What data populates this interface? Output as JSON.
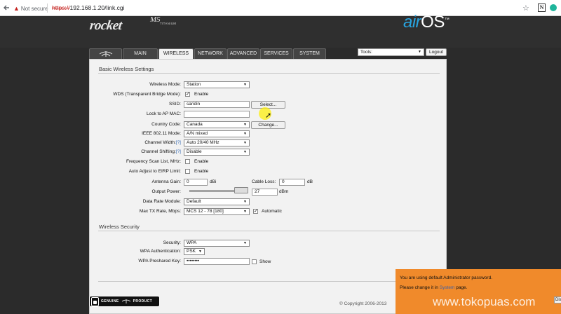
{
  "browser": {
    "security_label": "Not secure",
    "url_scheme": "https://",
    "url_host": "192.168.1.20/link.cgi"
  },
  "header": {
    "brand_rocket": "rocket",
    "brand_model": "M5",
    "brand_variant": "TITANIUM",
    "brand_air": "air",
    "brand_os": "OS",
    "brand_tm": "™"
  },
  "tabs": [
    {
      "label": ""
    },
    {
      "label": "MAIN"
    },
    {
      "label": "WIRELESS"
    },
    {
      "label": "NETWORK"
    },
    {
      "label": "ADVANCED"
    },
    {
      "label": "SERVICES"
    },
    {
      "label": "SYSTEM"
    }
  ],
  "active_tab": "WIRELESS",
  "toolbar": {
    "tools_label": "Tools:",
    "logout_label": "Logout"
  },
  "basic": {
    "title": "Basic Wireless Settings",
    "wireless_mode_label": "Wireless Mode:",
    "wireless_mode_value": "Station",
    "wds_label": "WDS (Transparent Bridge Mode):",
    "wds_option": "Enable",
    "wds_checked": true,
    "ssid_label": "SSID:",
    "ssid_value": "saridin",
    "select_btn": "Select...",
    "lock_ap_label": "Lock to AP MAC:",
    "lock_ap_value": "",
    "country_label": "Country Code:",
    "country_value": "Canada",
    "change_btn": "Change...",
    "ieee_label": "IEEE 802.11 Mode:",
    "ieee_value": "A/N mixed",
    "channel_width_label": "Channel Width:",
    "channel_width_help": "[?]",
    "channel_width_value": "Auto 20/40 MHz",
    "channel_shift_label": "Channel Shifting:",
    "channel_shift_help": "[?]",
    "channel_shift_value": "Disable",
    "freq_scan_label": "Frequency Scan List, MHz:",
    "freq_scan_option": "Enable",
    "freq_scan_checked": false,
    "eirp_label": "Auto Adjust to EIRP Limit:",
    "eirp_option": "Enable",
    "eirp_checked": false,
    "antenna_gain_label": "Antenna Gain:",
    "antenna_gain_value": "0",
    "antenna_gain_unit": "dBi",
    "cable_loss_label": "Cable Loss:",
    "cable_loss_value": "0",
    "cable_loss_unit": "dB",
    "output_power_label": "Output Power:",
    "output_power_value": "27",
    "output_power_unit": "dBm",
    "output_power_level": 1.0,
    "data_rate_label": "Data Rate Module:",
    "data_rate_value": "Default",
    "max_tx_label": "Max TX Rate, Mbps:",
    "max_tx_value": "MCS 12 - 78 [180]",
    "auto_option": "Automatic",
    "auto_checked": true
  },
  "security": {
    "title": "Wireless Security",
    "security_label": "Security:",
    "security_value": "WPA",
    "wpa_auth_label": "WPA Authentication:",
    "wpa_auth_value": "PSK",
    "wpa_key_label": "WPA Preshared Key:",
    "wpa_key_value": "••••••••",
    "show_option": "Show",
    "show_checked": false
  },
  "footer": {
    "genuine_left": "GENUINE",
    "genuine_right": "PRODUCT",
    "copyright": "© Copyright 2006-2013"
  },
  "notice": {
    "line1": "You are using default Administrator password.",
    "line2_prefix": "Please change it in ",
    "line2_link": "System",
    "line2_suffix": " page.",
    "dismiss": "Dismiss"
  },
  "watermark": "www.tokopuas.com",
  "colors": {
    "header_bg": "#2f2f2f",
    "panel_bg": "#f2f2f2",
    "air_blue": "#28a4e0",
    "notice_orange": "#f08a2b",
    "not_secure_red": "#c5221f"
  }
}
